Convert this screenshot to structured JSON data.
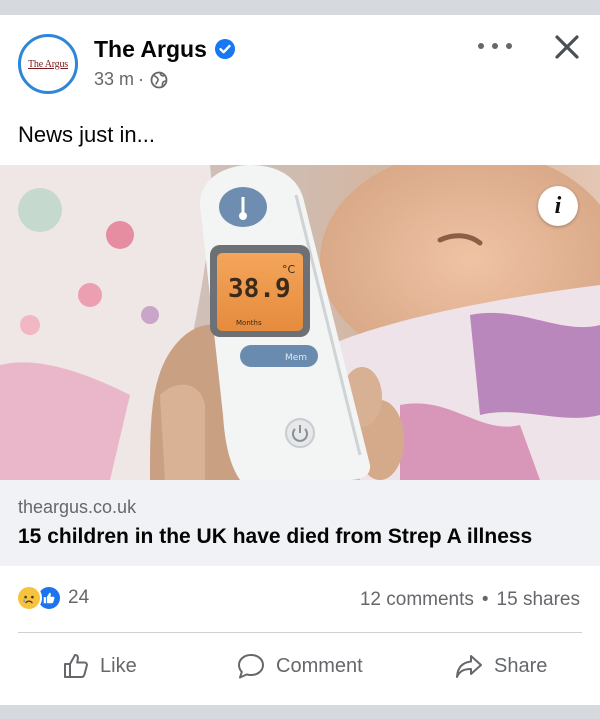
{
  "post": {
    "page_name": "The Argus",
    "avatar_text": "The Argus",
    "time": "33 m",
    "separator": "·",
    "text": "News just in...",
    "image_info": "i",
    "link_domain": "theargus.co.uk",
    "link_title": "15 children in the UK have died from Strep A illness"
  },
  "thermometer": {
    "reading": "38.9",
    "unit": "°C",
    "age_label": "Months",
    "mode_label": "Mem"
  },
  "engagement": {
    "reaction_count": "24",
    "comments": "12 comments",
    "dot": "•",
    "shares": "15 shares"
  },
  "actions": {
    "like": "Like",
    "comment": "Comment",
    "share": "Share"
  },
  "colors": {
    "accent": "#1877f2",
    "secondary_text": "#65676b",
    "link_bg": "#f0f2f5"
  }
}
